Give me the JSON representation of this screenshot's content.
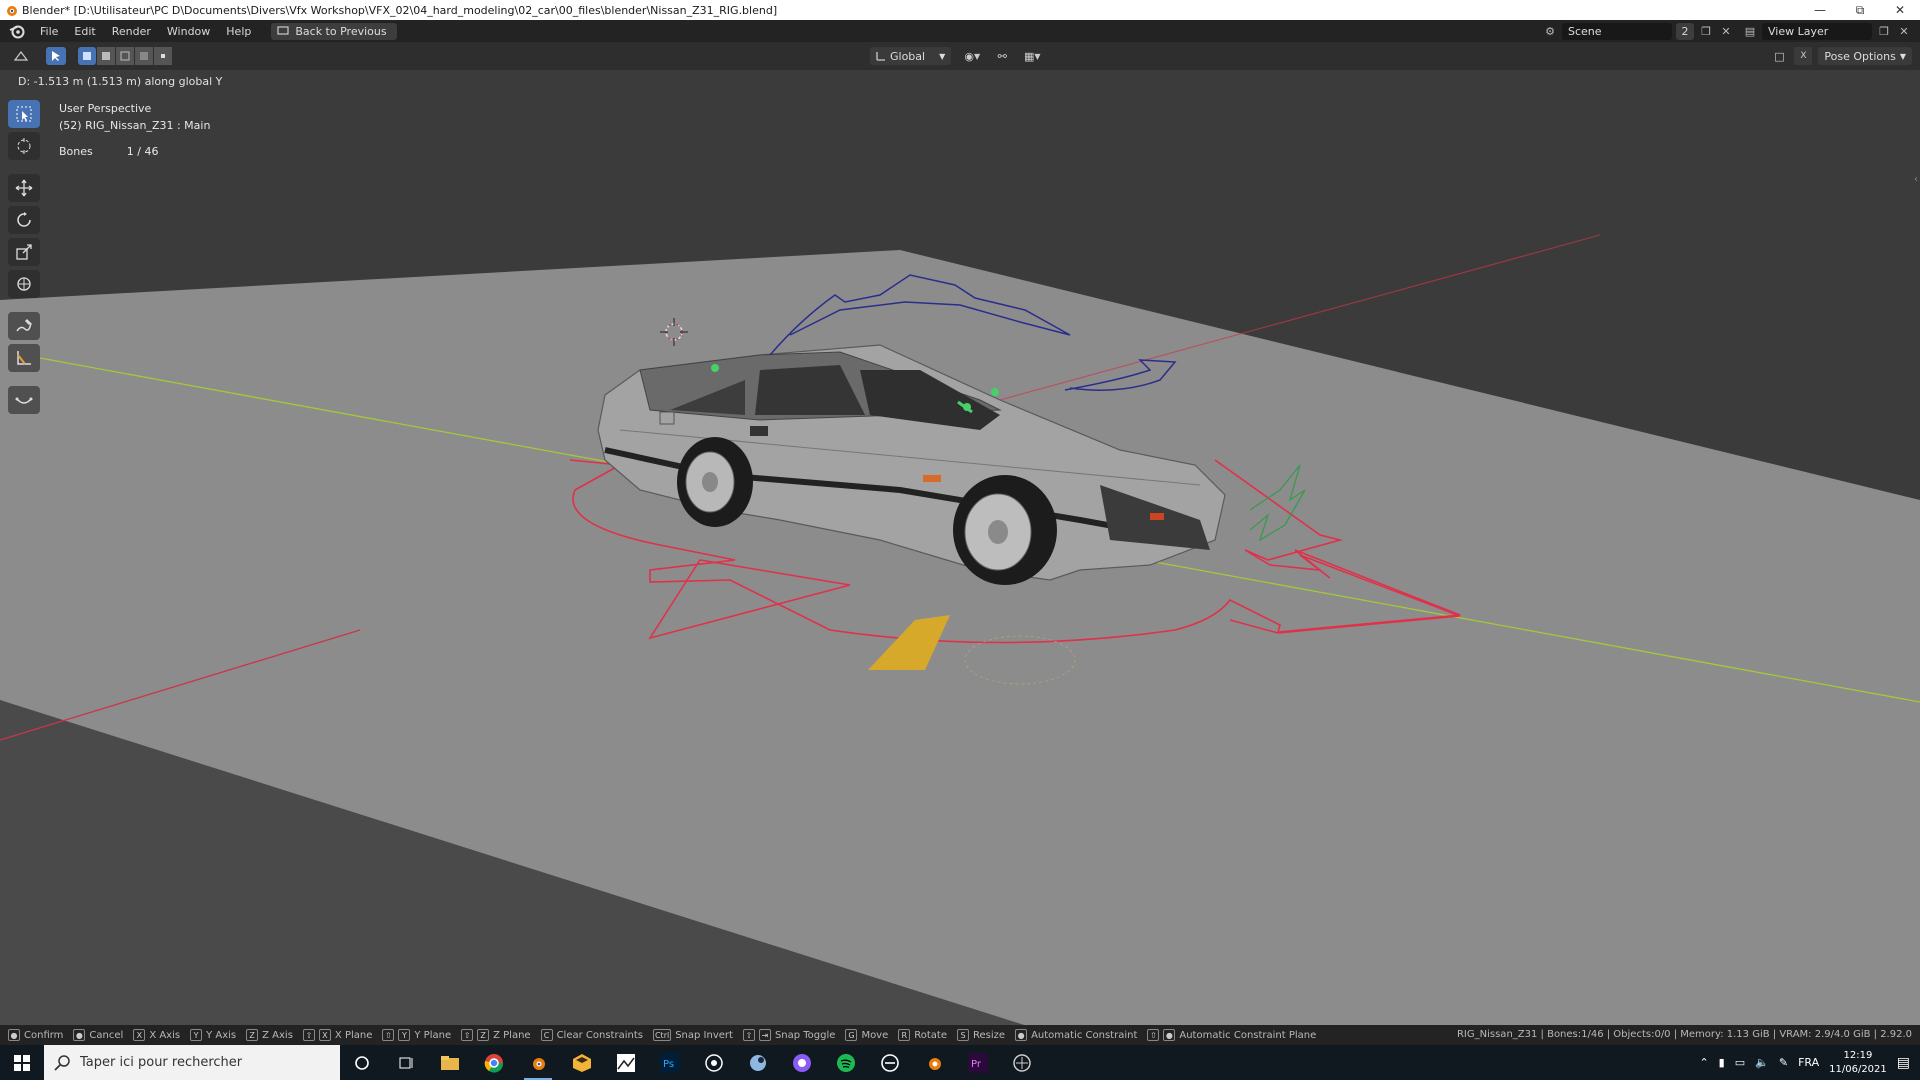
{
  "window": {
    "title": "Blender* [D:\\Utilisateur\\PC D\\Documents\\Divers\\Vfx Workshop\\VFX_02\\04_hard_modeling\\02_car\\00_files\\blender\\Nissan_Z31_RIG.blend]",
    "controls": [
      "minimize-icon",
      "restore-icon",
      "close-icon"
    ]
  },
  "menubar": {
    "items": [
      "File",
      "Edit",
      "Render",
      "Window",
      "Help"
    ],
    "back_button": "Back to Previous",
    "scene_label": "Scene",
    "scene_users": "2",
    "view_layer_label": "View Layer"
  },
  "header": {
    "orientation": "Global",
    "pose_options": "Pose Options"
  },
  "viewport": {
    "operator_text": "D: -1.513 m (1.513 m) along global Y",
    "perspective": "User Perspective",
    "object_info": "(52) RIG_Nissan_Z31 : Main",
    "bones_label": "Bones",
    "bones_value": "1 / 46"
  },
  "toolbar": {
    "tools": [
      "select-box-icon",
      "cursor-icon",
      "move-icon",
      "rotate-icon",
      "scale-icon",
      "transform-icon",
      "annotate-icon",
      "measure-icon",
      "bend-bone-icon"
    ],
    "active": "select-box-icon"
  },
  "statusbar": {
    "items": [
      {
        "key": "",
        "label": "Confirm"
      },
      {
        "key": "",
        "label": "Cancel"
      },
      {
        "key": "X",
        "label": "X Axis"
      },
      {
        "key": "Y",
        "label": "Y Axis"
      },
      {
        "key": "Z",
        "label": "Z Axis"
      },
      {
        "key": "X",
        "label": "X Plane"
      },
      {
        "key": "Y",
        "label": "Y Plane"
      },
      {
        "key": "Z",
        "label": "Z Plane"
      },
      {
        "key": "C",
        "label": "Clear Constraints"
      },
      {
        "key": "Ctrl",
        "label": "Snap Invert"
      },
      {
        "key": "",
        "label": "Snap Toggle"
      },
      {
        "key": "G",
        "label": "Move"
      },
      {
        "key": "R",
        "label": "Rotate"
      },
      {
        "key": "S",
        "label": "Resize"
      },
      {
        "key": "",
        "label": "Automatic Constraint"
      },
      {
        "key": "",
        "label": "Automatic Constraint Plane"
      }
    ],
    "stats": "RIG_Nissan_Z31 | Bones:1/46 | Objects:0/0 | Memory: 1.13 GiB | VRAM: 2.9/4.0 GiB | 2.92.0"
  },
  "taskbar": {
    "search_placeholder": "Taper ici pour rechercher",
    "language": "FRA",
    "time": "12:19",
    "date": "11/06/2021"
  },
  "colors": {
    "accent": "#4772b3",
    "viewport_bg": "#3b3b3b",
    "ground": "#8c8c8c",
    "x_axis": "#c8374a",
    "y_axis": "#a4c83a",
    "control_red": "#e0304a",
    "control_blue": "#2a2e8a",
    "control_green": "#3a9a50"
  }
}
